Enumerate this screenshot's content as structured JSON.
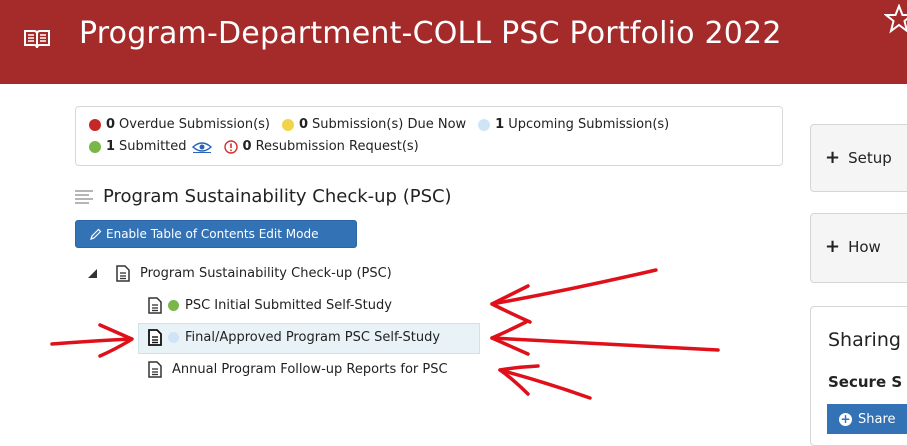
{
  "header": {
    "title": "Program-Department-COLL PSC Portfolio 2022",
    "background_color": "#a52b2b",
    "icons": [
      "book-icon",
      "star-icon"
    ]
  },
  "status": {
    "overdue": {
      "count": "0",
      "label": "Overdue Submission(s)",
      "color": "#c62828"
    },
    "due_now": {
      "count": "0",
      "label": "Submission(s) Due Now",
      "color": "#f1d44a"
    },
    "upcoming": {
      "count": "1",
      "label": "Upcoming Submission(s)",
      "color": "#cfe4f7"
    },
    "submitted": {
      "count": "1",
      "label": "Submitted",
      "color": "#7ab648"
    },
    "resubmission": {
      "count": "0",
      "label": "Resubmission Request(s)",
      "color": "#d32f2f"
    }
  },
  "section": {
    "title": "Program Sustainability Check-up (PSC)"
  },
  "enable_button": {
    "label": "Enable Table of Contents Edit Mode",
    "color": "#3272b5"
  },
  "tree": {
    "root": {
      "label": "Program Sustainability Check-up (PSC)"
    },
    "children": [
      {
        "label": "PSC Initial Submitted Self-Study",
        "status": "submitted",
        "dot_color": "#7ab648"
      },
      {
        "label": "Final/Approved Program PSC Self-Study",
        "status": "upcoming",
        "dot_color": "#cfe4f7",
        "selected": true
      },
      {
        "label": "Annual Program Follow-up Reports for PSC"
      }
    ]
  },
  "right_panels": {
    "setup": {
      "label": "Setup"
    },
    "how": {
      "label": "How"
    },
    "sharing": {
      "title": "Sharing",
      "secure_label": "Secure S",
      "share_button": "Share"
    }
  },
  "annotation_color": "#e0101a"
}
